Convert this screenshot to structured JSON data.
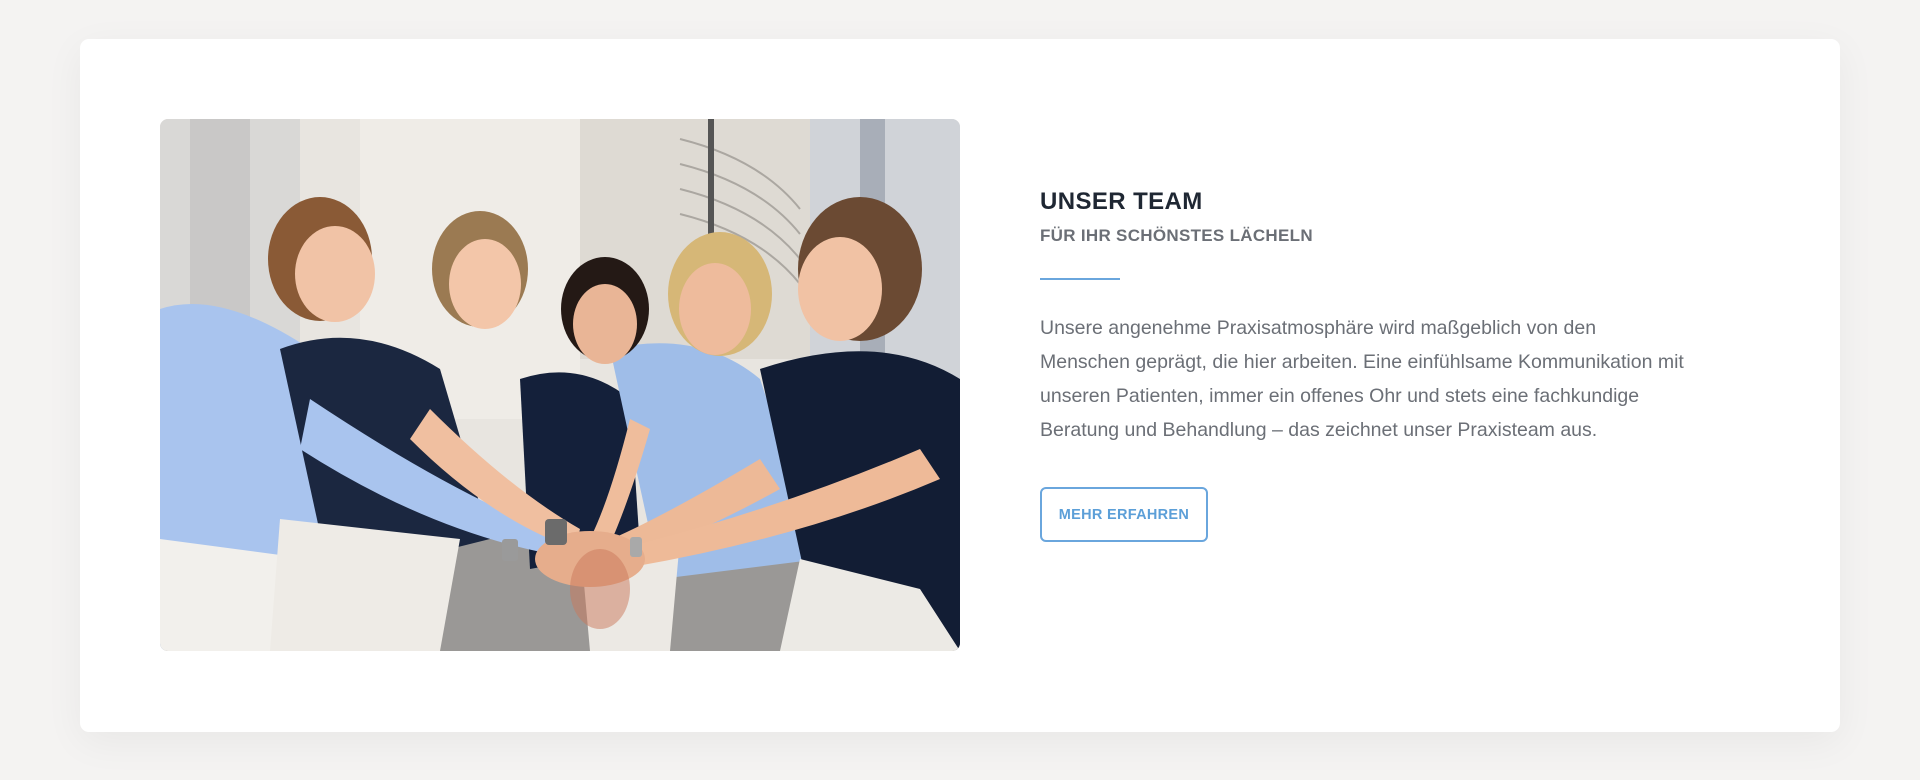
{
  "section": {
    "title": "UNSER TEAM",
    "subtitle": "FÜR IHR SCHÖNSTES LÄCHELN",
    "body": "Unsere angenehme Praxisatmosphäre wird maßgeblich von den Menschen geprägt, die hier arbeiten. Eine einfühlsame Kommunikation mit unseren Patienten, immer ein offenes Ohr und stets eine fachkundige Beratung und Behandlung – das zeichnet unser Praxisteam aus.",
    "cta_label": "MEHR ERFAHREN"
  },
  "colors": {
    "page_background": "#f4f3f2",
    "card_background": "#ffffff",
    "accent": "#6aa6dd",
    "title": "#1f2733",
    "text": "#6b6f76"
  }
}
